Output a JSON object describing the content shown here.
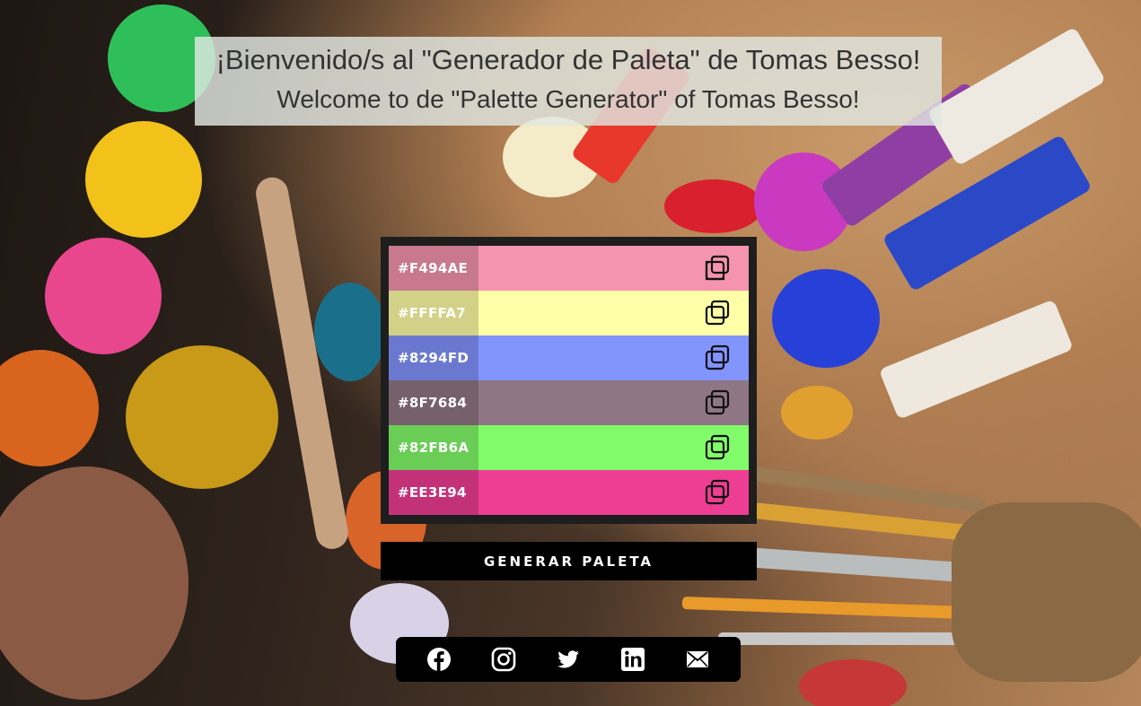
{
  "header": {
    "title_es": "¡Bienvenido/s al \"Generador de Paleta\" de Tomas Besso!",
    "title_en": "Welcome to de \"Palette Generator\" of Tomas Besso!"
  },
  "palette": [
    {
      "hex": "#F494AE",
      "color": "#F494AE"
    },
    {
      "hex": "#FFFFA7",
      "color": "#FFFFA7"
    },
    {
      "hex": "#8294FD",
      "color": "#8294FD"
    },
    {
      "hex": "#8F7684",
      "color": "#8F7684"
    },
    {
      "hex": "#82FB6A",
      "color": "#82FB6A"
    },
    {
      "hex": "#EE3E94",
      "color": "#EE3E94"
    }
  ],
  "generate_button": {
    "label": "GENERAR PALETA"
  },
  "social": [
    {
      "icon": "facebook-icon"
    },
    {
      "icon": "instagram-icon"
    },
    {
      "icon": "twitter-icon"
    },
    {
      "icon": "linkedin-icon"
    },
    {
      "icon": "email-icon"
    }
  ]
}
